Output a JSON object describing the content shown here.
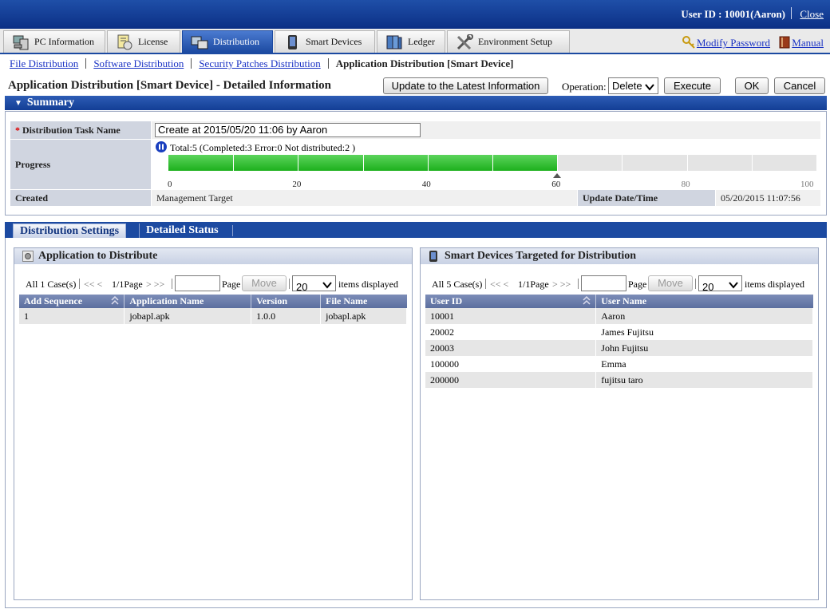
{
  "topbar": {
    "user": "User ID : 10001(Aaron)",
    "close": "Close"
  },
  "tabs": [
    {
      "label": "PC Information",
      "icon": "pc-icon"
    },
    {
      "label": "License",
      "icon": "license-icon"
    },
    {
      "label": "Distribution",
      "icon": "distribution-icon",
      "active": true
    },
    {
      "label": "Smart Devices",
      "icon": "smartphone-icon"
    },
    {
      "label": "Ledger",
      "icon": "ledger-icon"
    },
    {
      "label": "Environment Setup",
      "icon": "tools-icon"
    }
  ],
  "links": {
    "modify_password": "Modify Password",
    "manual": "Manual"
  },
  "subnav": {
    "items": [
      "File Distribution",
      "Software Distribution",
      "Security Patches Distribution"
    ],
    "current": "Application Distribution [Smart Device]"
  },
  "titlerow": {
    "title": "Application Distribution [Smart Device] - Detailed Information",
    "update_btn": "Update to the Latest Information",
    "operation_label": "Operation:",
    "operation_value": "Delete",
    "execute_btn": "Execute",
    "ok_btn": "OK",
    "cancel_btn": "Cancel"
  },
  "summary": {
    "header": "Summary",
    "task_name_label": "Distribution Task Name",
    "task_name_required": "*",
    "task_name_value": "Create at 2015/05/20 11:06 by Aaron",
    "progress_label": "Progress",
    "progress_text": "Total:5  (Completed:3  Error:0  Not distributed:2 )",
    "progress_fraction": 0.6,
    "progress_ticks": [
      "0",
      "20",
      "40",
      "60",
      "80",
      "100"
    ],
    "created_label": "Created",
    "created_value": "Management Target",
    "update_label": "Update Date/Time",
    "update_value": "05/20/2015 11:07:56"
  },
  "lowertabs": {
    "settings": "Distribution Settings",
    "status": "Detailed Status"
  },
  "app_panel": {
    "title": "Application to Distribute",
    "count": "All 1 Case(s)",
    "nav_prev": "<< <",
    "page": "1/1Page",
    "nav_next": "> >>",
    "page_input": "",
    "page_label": "Page",
    "move_btn": "Move",
    "per_page": "20",
    "items_label": "items displayed",
    "columns": [
      "Add Sequence",
      "Application Name",
      "Version",
      "File Name"
    ],
    "rows": [
      [
        "1",
        "jobapl.apk",
        "1.0.0",
        "jobapl.apk"
      ]
    ]
  },
  "device_panel": {
    "title": "Smart Devices Targeted for Distribution",
    "count": "All 5 Case(s)",
    "nav_prev": "<< <",
    "page": "1/1Page",
    "nav_next": "> >>",
    "page_input": "",
    "page_label": "Page",
    "move_btn": "Move",
    "per_page": "20",
    "items_label": "items displayed",
    "columns": [
      "User ID",
      "User Name"
    ],
    "rows": [
      [
        "10001",
        "Aaron"
      ],
      [
        "20002",
        "James Fujitsu"
      ],
      [
        "20003",
        "John Fujitsu"
      ],
      [
        "100000",
        "Emma"
      ],
      [
        "200000",
        "fujitsu taro"
      ]
    ]
  },
  "colors": {
    "accent": "#1c4aa1",
    "progress": "#1db01d",
    "link": "#1a32c4"
  }
}
